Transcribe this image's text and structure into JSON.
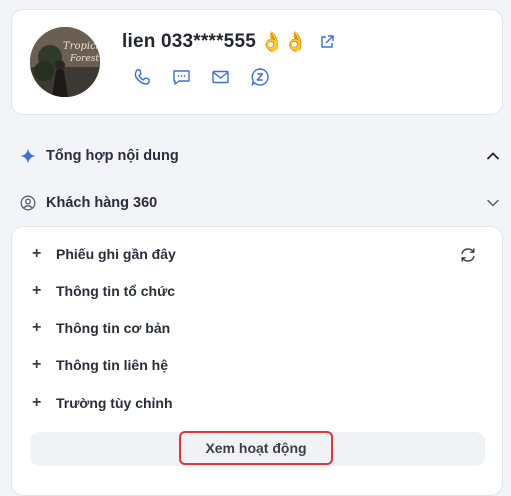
{
  "contact": {
    "name": "lien 033****555",
    "emoji": "👌👌",
    "avatar_text_1": "Tropical",
    "avatar_text_2": "Forest"
  },
  "icons": {
    "external_link": "external-link-icon",
    "phone": "phone-icon",
    "sms": "sms-icon",
    "email": "email-icon",
    "zalo": "zalo-icon",
    "sparkle": "sparkle-icon",
    "user_circle": "user-circle-icon",
    "refresh": "refresh-icon",
    "chevron_up": "chevron-up-icon",
    "chevron_down": "chevron-down-icon"
  },
  "sections": {
    "summary": "Tổng hợp nội dung",
    "customer360": "Khách hàng 360"
  },
  "items": [
    {
      "label": "Phiếu ghi gần đây"
    },
    {
      "label": "Thông tin tổ chức"
    },
    {
      "label": "Thông tin cơ bản"
    },
    {
      "label": "Thông tin liên hệ"
    },
    {
      "label": "Trường tùy chỉnh"
    }
  ],
  "actions": {
    "view_activity": "Xem hoạt động"
  },
  "colors": {
    "accent": "#3b6fd8",
    "highlight_border": "#e0363d"
  }
}
